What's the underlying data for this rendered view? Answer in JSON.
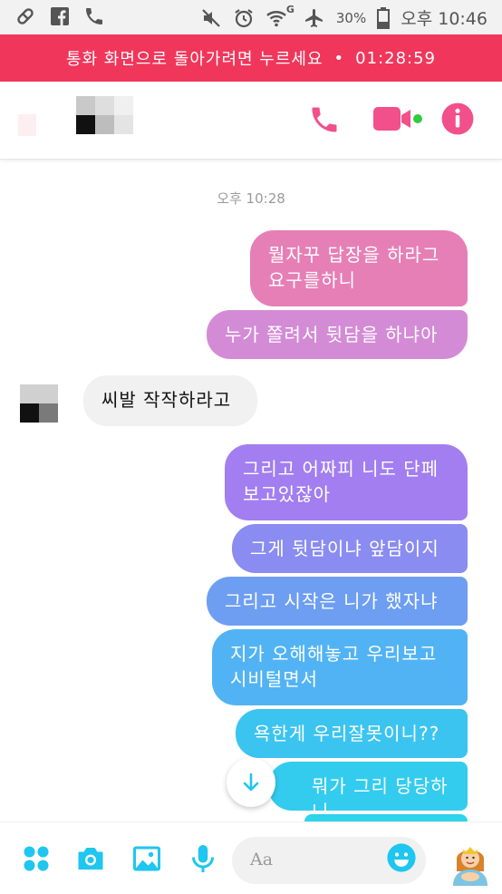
{
  "status_bar": {
    "carrier_indicator": "G",
    "battery_percent": "30%",
    "time": "오후 10:46",
    "icons": [
      "pill-icon",
      "facebook-icon",
      "phone-icon",
      "mute-icon",
      "alarm-icon",
      "wifi-icon",
      "airplane-icon",
      "battery-icon"
    ]
  },
  "call_banner": {
    "text": "통화 화면으로 돌아가려면 누르세요",
    "separator": "•",
    "duration": "01:28:59",
    "color": "#f0365a"
  },
  "header": {
    "icons": [
      "phone-call-icon",
      "video-call-icon",
      "info-icon"
    ],
    "accent_color": "#f2508a",
    "online_color": "#2ecc40"
  },
  "thread": {
    "timestamp": "오후 10:28",
    "messages": [
      {
        "side": "out",
        "text": "뭘자꾸 답장을 하라그\n요구를하니",
        "color": "#e67fb6"
      },
      {
        "side": "out",
        "text": "누가 쫄려서 뒷담을 하냐아",
        "color": "#d48bd6"
      },
      {
        "side": "in",
        "text": "씨발 작작하라고",
        "color": "#f1f1f1"
      },
      {
        "side": "out",
        "text": "그리고 어짜피 니도 단페\n보고있잖아",
        "color": "#a27ef0"
      },
      {
        "side": "out",
        "text": "그게 뒷담이냐 앞담이지",
        "color": "#8a8cf2"
      },
      {
        "side": "out",
        "text": "그리고 시작은 니가 했자냐",
        "color": "#6d9ef2"
      },
      {
        "side": "out",
        "text": "지가 오해해놓고 우리보고\n시비털면서",
        "color": "#52b3f4"
      },
      {
        "side": "out",
        "text": "욕한게 우리잘못이니??",
        "color": "#3cc4f0"
      },
      {
        "side": "out",
        "text": "뭐가 그리 당당하니",
        "color": "#33ccee"
      }
    ]
  },
  "composer": {
    "placeholder": "Aa",
    "icons": [
      "more-apps-icon",
      "camera-icon",
      "gallery-icon",
      "microphone-icon",
      "emoji-icon",
      "like-sticker-icon"
    ],
    "accent_color": "#1ec6f0"
  }
}
